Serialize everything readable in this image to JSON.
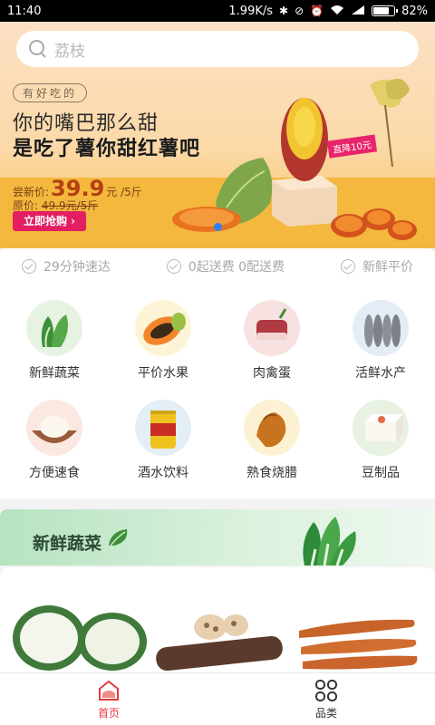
{
  "status_bar": {
    "time": "11:40",
    "net_speed": "1.99K/s",
    "battery_percent": "82%",
    "battery_level": 0.82
  },
  "search": {
    "placeholder": "荔枝"
  },
  "banner": {
    "tag": "有好吃的",
    "headline_line1": "你的嘴巴那么甜",
    "headline_line2": "是吃了薯你甜红薯吧",
    "new_price_label": "尝新价:",
    "new_price_value": "39.9",
    "new_price_unit": "元 /5斤",
    "old_price_label": "原价:",
    "old_price_value": "49.9元/5斤",
    "buy_button": "立即抢购 ›",
    "discount_badge": "直降10元"
  },
  "features": [
    {
      "label": "29分钟速达"
    },
    {
      "label": "0起送费 0配送费"
    },
    {
      "label": "新鲜平价"
    }
  ],
  "categories": [
    {
      "label": "新鲜蔬菜",
      "icon": "vegetable-icon"
    },
    {
      "label": "平价水果",
      "icon": "papaya-icon"
    },
    {
      "label": "肉禽蛋",
      "icon": "meat-icon"
    },
    {
      "label": "活鲜水产",
      "icon": "shrimp-icon"
    },
    {
      "label": "方便速食",
      "icon": "instant-food-icon"
    },
    {
      "label": "酒水饮料",
      "icon": "drink-can-icon"
    },
    {
      "label": "熟食烧腊",
      "icon": "roast-chicken-icon"
    },
    {
      "label": "豆制品",
      "icon": "tofu-icon"
    }
  ],
  "section": {
    "title": "新鲜蔬菜"
  },
  "products": [
    {
      "name": "winter-melon"
    },
    {
      "name": "lotus-root"
    },
    {
      "name": "carrot"
    }
  ],
  "bottom_nav": {
    "home_label": "首页",
    "category_label": "品类",
    "active_color": "#e7393f"
  }
}
